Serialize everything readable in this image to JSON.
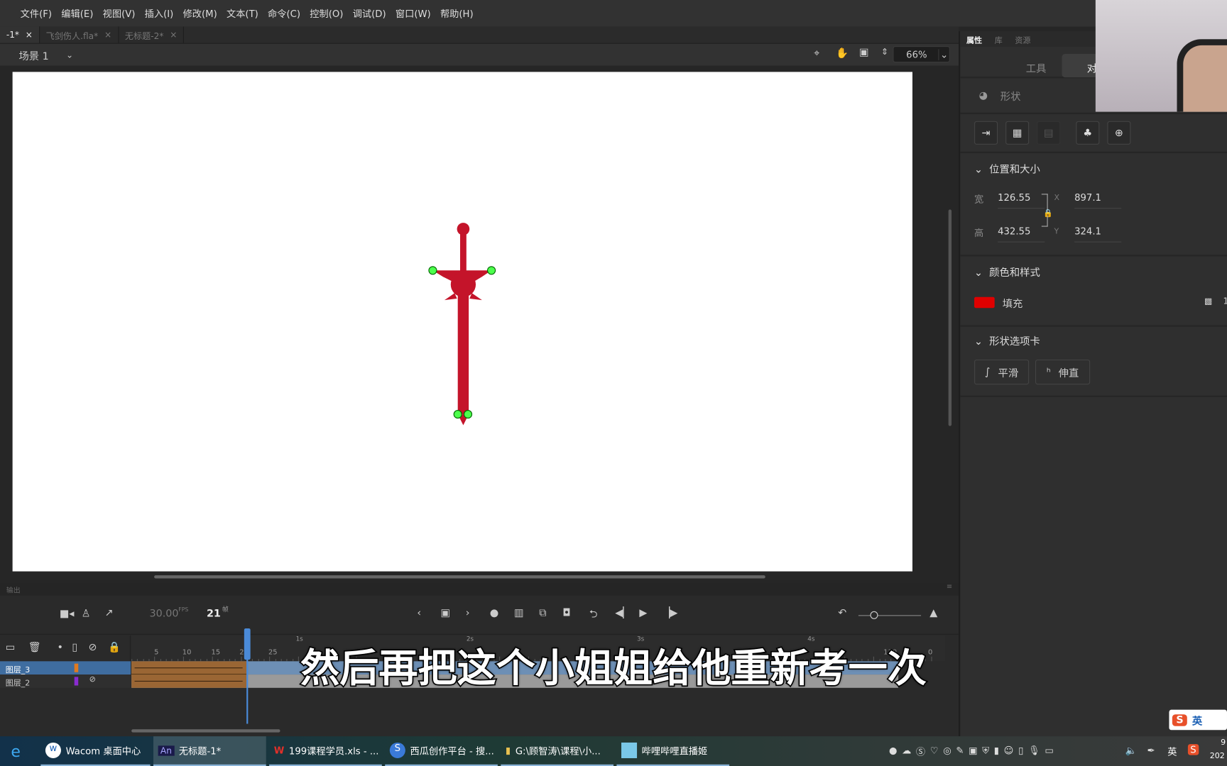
{
  "menu": [
    "文件(F)",
    "编辑(E)",
    "视图(V)",
    "插入(I)",
    "修改(M)",
    "文本(T)",
    "命令(C)",
    "控制(O)",
    "调试(D)",
    "窗口(W)",
    "帮助(H)"
  ],
  "tabs": [
    {
      "label": "-1*",
      "active": true
    },
    {
      "label": "飞剑伤人.fla*",
      "active": false
    },
    {
      "label": "无标题-2*",
      "active": false
    }
  ],
  "scene": {
    "label": "场景 1"
  },
  "zoom": "66%",
  "panel": {
    "tabs": [
      "属性",
      "库",
      "资源"
    ],
    "mode_tabs": [
      "工具",
      "对象"
    ],
    "object_type": "形状",
    "position_section": "位置和大小",
    "width_label": "宽",
    "width": "126.55",
    "height_label": "高",
    "height": "432.55",
    "x_label": "X",
    "x": "897.1",
    "y_label": "Y",
    "y": "324.1",
    "color_section": "颜色和样式",
    "fill_label": "填充",
    "fill_color": "#e00000",
    "alpha": "1",
    "shape_section": "形状选项卡",
    "smooth": "平滑",
    "straighten": "伸直"
  },
  "output_label": "输出",
  "timeline": {
    "fps": "30.00",
    "fps_unit": "FPS",
    "frame": "21",
    "frame_unit": "帧",
    "ruler": [
      "5",
      "10",
      "15",
      "20",
      "25",
      "130",
      "0"
    ],
    "seconds": [
      "1s",
      "2s",
      "3s",
      "4s"
    ],
    "layers": [
      {
        "name": "图层_3",
        "color": "#e07a20",
        "selected": true
      },
      {
        "name": "图层_2",
        "color": "#8a2bd0",
        "selected": false
      }
    ]
  },
  "subtitle": "然后再把这个小姐姐给他重新考一次",
  "taskbar": {
    "items": [
      "Wacom 桌面中心",
      "无标题-1*",
      "199课程学员.xls - ...",
      "西瓜创作平台 - 搜...",
      "G:\\顾智涛\\课程\\小...",
      "哔哩哔哩直播姬"
    ],
    "ime": "英",
    "clock_partial": "9",
    "date_partial": "202"
  }
}
